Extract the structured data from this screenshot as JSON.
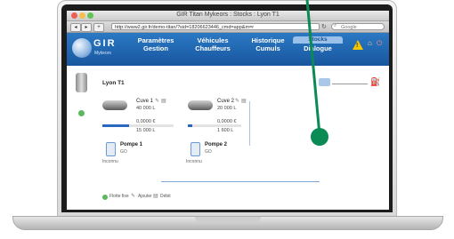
{
  "browser": {
    "window_title": "GIR Titan Mykeors : Stocks : Lyon T1",
    "url": "http://www2.gir.fr/demo-titan/?sid=18206623446_cmd=app&m=r",
    "search_placeholder": "Google",
    "nav": {
      "back": "◂",
      "forward": "▸",
      "add": "+"
    }
  },
  "app": {
    "logo": "GIR",
    "logo_sub": "Mykeors",
    "menu": [
      {
        "line1": "Paramètres",
        "line2": "Gestion"
      },
      {
        "line1": "Véhicules",
        "line2": "Chauffeurs"
      },
      {
        "line1": "Historique",
        "line2": "Cumuls"
      }
    ],
    "active_menu": {
      "tab": "Stocks",
      "line2": "Dialogue"
    }
  },
  "site": {
    "name": "Lyon T1"
  },
  "tanks": [
    {
      "name": "Cuve 1",
      "volume": "40 000 L",
      "value": "0,0000 €",
      "level": "15 000 L",
      "fill_fraction": 0.375
    },
    {
      "name": "Cuve 2",
      "volume": "20 000 L",
      "value": "0,0000 €",
      "level": "1 600 L",
      "fill_fraction": 0.08
    }
  ],
  "pumps": [
    {
      "name": "Pompe 1",
      "fuel": "GO",
      "status": "Inconnu"
    },
    {
      "name": "Pompe 2",
      "fuel": "GO",
      "status": "Inconnu"
    }
  ],
  "legend": [
    "Flotte fixe",
    "Ajouter",
    "Débit"
  ],
  "colors": {
    "accent": "#1f66b3",
    "annotation": "#0a8a55",
    "ok": "#5cb85c",
    "warning": "#f6c700"
  }
}
